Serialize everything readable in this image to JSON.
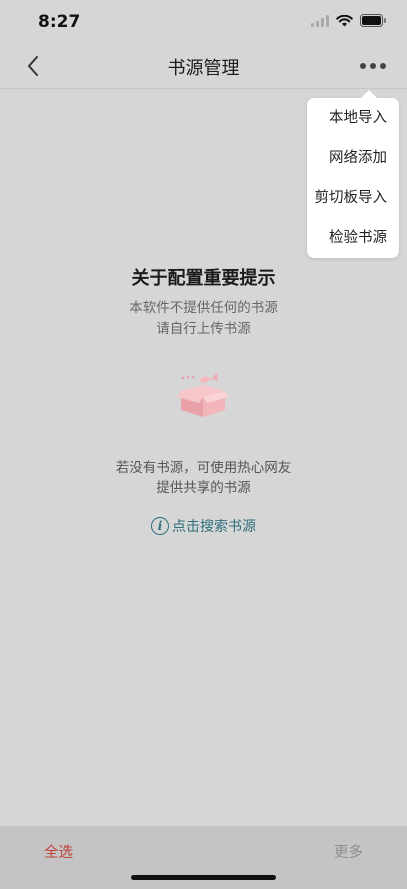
{
  "status": {
    "time": "8:27"
  },
  "nav": {
    "title": "书源管理"
  },
  "popup": {
    "items": [
      {
        "label": "本地导入"
      },
      {
        "label": "网络添加"
      },
      {
        "label": "剪切板导入"
      },
      {
        "label": "检验书源"
      }
    ]
  },
  "notice": {
    "title": "关于配置重要提示",
    "line1": "本软件不提供任何的书源",
    "line2": "请自行上传书源"
  },
  "hint": {
    "line1": "若没有书源，可使用热心网友",
    "line2": "提供共享的书源"
  },
  "search_link": {
    "icon_letter": "i",
    "label": "点击搜索书源"
  },
  "bottom": {
    "select_all": "全选",
    "more": "更多"
  },
  "colors": {
    "background": "#d6d6d6",
    "accent_red": "#c0433a",
    "link_teal": "#2f6f7d",
    "box_pink": "#e9a3a8"
  },
  "icons": {
    "back": "chevron-left-icon",
    "more": "ellipsis-icon",
    "info": "info-icon",
    "illustration": "empty-box-icon"
  }
}
